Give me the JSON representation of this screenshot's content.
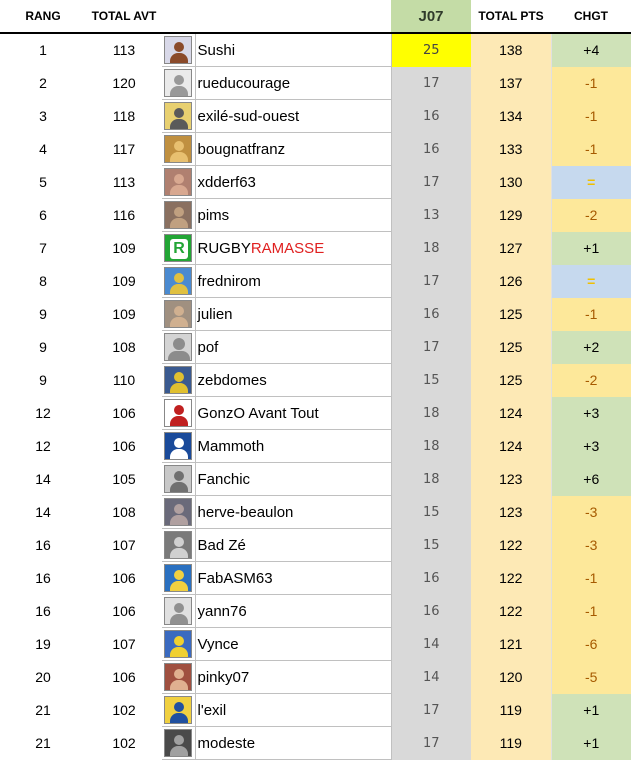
{
  "headers": {
    "rang": "RANG",
    "total_avt": "TOTAL AVT",
    "journee": "J07",
    "total_pts": "TOTAL PTS",
    "chgt": "CHGT"
  },
  "colors": {
    "best_score": "#ffff00",
    "journee_column": "#d9d9d9",
    "total_pts_column": "#fde9b5",
    "change_up": "#cfe2b8",
    "change_down": "#fde89a",
    "change_same": "#c6d9ee",
    "name_highlight": "#e02020"
  },
  "rows": [
    {
      "rang": "1",
      "avt": "113",
      "name": "Sushi",
      "j": "25",
      "tp": "138",
      "chgt": "+4",
      "trend": "up",
      "best": true,
      "avatar": "figure-avatar",
      "av_bg": "#d8d8e8",
      "av_fg": "#8a4a2a"
    },
    {
      "rang": "2",
      "avt": "120",
      "name": "rueducourage",
      "j": "17",
      "tp": "137",
      "chgt": "-1",
      "trend": "down",
      "avatar": "robot-avatar",
      "av_bg": "#eaeaea",
      "av_fg": "#999999"
    },
    {
      "rang": "3",
      "avt": "118",
      "name": "exilé-sud-ouest",
      "j": "16",
      "tp": "134",
      "chgt": "-1",
      "trend": "down",
      "avatar": "yellow-avatar",
      "av_bg": "#e8d070",
      "av_fg": "#5a5a5a"
    },
    {
      "rang": "4",
      "avt": "117",
      "name": "bougnatfranz",
      "j": "16",
      "tp": "133",
      "chgt": "-1",
      "trend": "down",
      "avatar": "cartoon-avatar",
      "av_bg": "#c09040",
      "av_fg": "#e8c070"
    },
    {
      "rang": "5",
      "avt": "113",
      "name": "xdderf63",
      "j": "17",
      "tp": "130",
      "chgt": "=",
      "trend": "same",
      "avatar": "faces-avatar",
      "av_bg": "#b08070",
      "av_fg": "#d8a890"
    },
    {
      "rang": "6",
      "avt": "116",
      "name": "pims",
      "j": "13",
      "tp": "129",
      "chgt": "-2",
      "trend": "down",
      "avatar": "crowd-avatar",
      "av_bg": "#8a7060",
      "av_fg": "#c0a080"
    },
    {
      "rang": "7",
      "avt": "109",
      "name_a": "RUGBY",
      "name_b": "RAMASSE",
      "j": "18",
      "tp": "127",
      "chgt": "+1",
      "trend": "up",
      "avatar": "rugby-logo-avatar",
      "av_bg": "#22a535",
      "av_fg": "#ffffff",
      "logo_letter": "R"
    },
    {
      "rang": "8",
      "avt": "109",
      "name": "frednirom",
      "j": "17",
      "tp": "126",
      "chgt": "=",
      "trend": "same",
      "avatar": "mascot-avatar",
      "av_bg": "#4a8ad0",
      "av_fg": "#e0c040"
    },
    {
      "rang": "9",
      "avt": "109",
      "name": "julien",
      "j": "16",
      "tp": "125",
      "chgt": "-1",
      "trend": "down",
      "avatar": "cat-avatar",
      "av_bg": "#a09080",
      "av_fg": "#d0b090"
    },
    {
      "rang": "9",
      "avt": "108",
      "name": "pof",
      "j": "17",
      "tp": "125",
      "chgt": "+2",
      "trend": "up",
      "avatar": "default-user-avatar",
      "av_bg": "#d4d4d4",
      "av_fg": "#8c8c8c"
    },
    {
      "rang": "9",
      "avt": "110",
      "name": "zebdomes",
      "j": "15",
      "tp": "125",
      "chgt": "-2",
      "trend": "down",
      "avatar": "player-avatar",
      "av_bg": "#3a5a90",
      "av_fg": "#e0c030"
    },
    {
      "rang": "12",
      "avt": "106",
      "name": "GonzO Avant Tout",
      "j": "18",
      "tp": "124",
      "chgt": "+3",
      "trend": "up",
      "avatar": "fist-logo-avatar",
      "av_bg": "#ffffff",
      "av_fg": "#c02020"
    },
    {
      "rang": "12",
      "avt": "106",
      "name": "Mammoth",
      "j": "18",
      "tp": "124",
      "chgt": "+3",
      "trend": "up",
      "avatar": "blue-logo-avatar",
      "av_bg": "#1a4a9a",
      "av_fg": "#ffffff"
    },
    {
      "rang": "14",
      "avt": "105",
      "name": "Fanchic",
      "j": "18",
      "tp": "123",
      "chgt": "+6",
      "trend": "up",
      "avatar": "building-avatar",
      "av_bg": "#c8c8c8",
      "av_fg": "#707070"
    },
    {
      "rang": "14",
      "avt": "108",
      "name": "herve-beaulon",
      "j": "15",
      "tp": "123",
      "chgt": "-3",
      "trend": "down",
      "avatar": "photo-avatar",
      "av_bg": "#6a6a7a",
      "av_fg": "#b0a0a0"
    },
    {
      "rang": "16",
      "avt": "107",
      "name": "Bad Zé",
      "j": "15",
      "tp": "122",
      "chgt": "-3",
      "trend": "down",
      "avatar": "portrait-avatar",
      "av_bg": "#7a7a7a",
      "av_fg": "#d0d0d0"
    },
    {
      "rang": "16",
      "avt": "106",
      "name": "FabASM63",
      "j": "16",
      "tp": "122",
      "chgt": "-1",
      "trend": "down",
      "avatar": "team-avatar",
      "av_bg": "#2a70c0",
      "av_fg": "#f0d040"
    },
    {
      "rang": "16",
      "avt": "106",
      "name": "yann76",
      "j": "16",
      "tp": "122",
      "chgt": "-1",
      "trend": "down",
      "avatar": "sketch-avatar",
      "av_bg": "#e0e0e0",
      "av_fg": "#909090"
    },
    {
      "rang": "19",
      "avt": "107",
      "name": "Vynce",
      "j": "14",
      "tp": "121",
      "chgt": "-6",
      "trend": "down",
      "avatar": "flag-avatar",
      "av_bg": "#3a6ac0",
      "av_fg": "#f0d030"
    },
    {
      "rang": "20",
      "avt": "106",
      "name": "pinky07",
      "j": "14",
      "tp": "120",
      "chgt": "-5",
      "trend": "down",
      "avatar": "group-avatar",
      "av_bg": "#a05040",
      "av_fg": "#e0b090"
    },
    {
      "rang": "21",
      "avt": "102",
      "name": "l'exil",
      "j": "17",
      "tp": "119",
      "chgt": "+1",
      "trend": "up",
      "avatar": "crest-avatar",
      "av_bg": "#f0d040",
      "av_fg": "#2050a0"
    },
    {
      "rang": "21",
      "avt": "102",
      "name": "modeste",
      "j": "17",
      "tp": "119",
      "chgt": "+1",
      "trend": "up",
      "avatar": "dark-photo-avatar",
      "av_bg": "#4a4a4a",
      "av_fg": "#a0a0a0"
    }
  ]
}
